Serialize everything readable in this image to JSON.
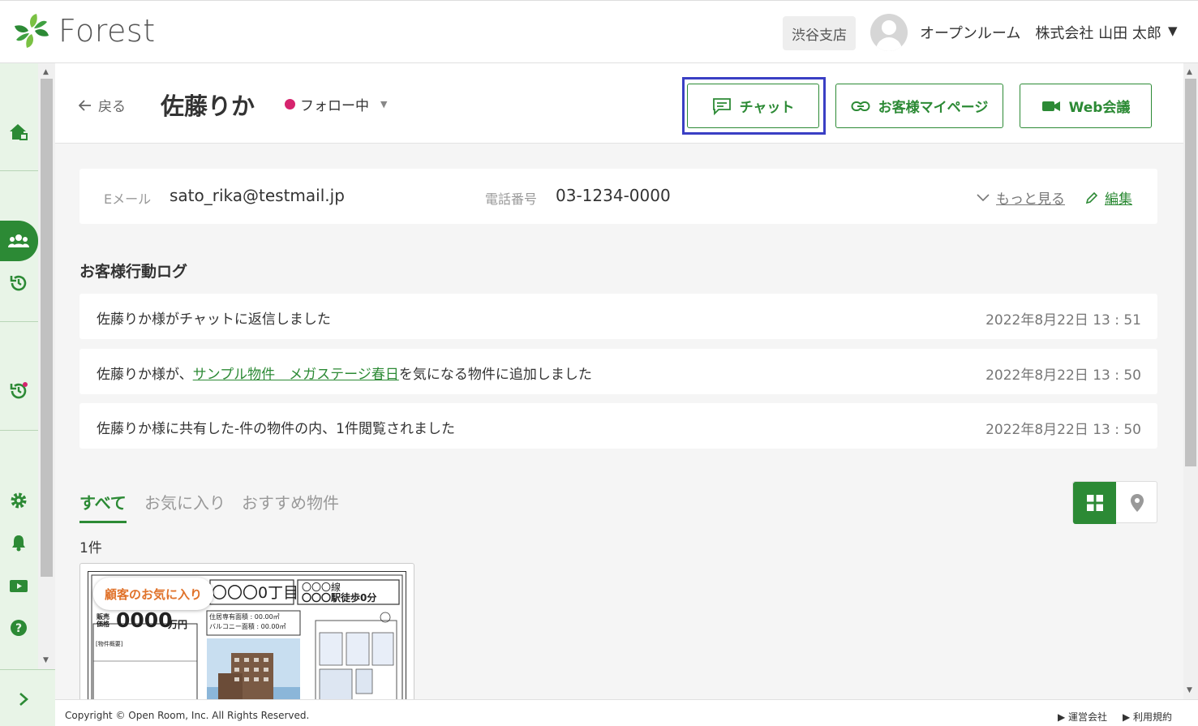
{
  "header": {
    "logo_text": "Forest",
    "branch": "渋谷支店",
    "user": "オープンルーム　株式会社 山田 太郎",
    "caret": "▼"
  },
  "topbar": {
    "back_label": "戻る",
    "customer_name": "佐藤りか",
    "status": "フォロー中",
    "chat_label": "チャット",
    "mypage_label": "お客様マイページ",
    "web_meeting_label": "Web会議"
  },
  "info": {
    "email_label": "Eメール",
    "email": "sato_rika@testmail.jp",
    "phone_label": "電話番号",
    "phone": "03-1234-0000",
    "more_label": "もっと見る",
    "edit_label": "編集"
  },
  "activity": {
    "title": "お客様行動ログ",
    "logs": [
      {
        "text": "佐藤りか様がチャットに返信しました",
        "time": "2022年8月22日 13 : 51"
      },
      {
        "text_before": "佐藤りか様が、",
        "link": "サンプル物件　メガステージ春日",
        "text_after": "を気になる物件に追加しました",
        "time": "2022年8月22日 13 : 50"
      },
      {
        "text": "佐藤りか様に共有した-件の物件の内、1件閲覧されました",
        "time": "2022年8月22日 13 : 50"
      }
    ]
  },
  "tabs": [
    "すべて",
    "お気に入り",
    "おすすめ物件"
  ],
  "count": "1件",
  "property": {
    "badge": "顧客のお気に入り",
    "flyer_address": "〇〇〇0丁目",
    "flyer_line": "〇〇〇線",
    "flyer_station": "〇〇〇駅徒歩0分",
    "flyer_price_label": "販売価格",
    "flyer_price": "0000",
    "flyer_price_unit": "万円",
    "flyer_area1": "住居専有面積 : 00.00㎡",
    "flyer_area2": "バルコニー面積 : 00.00㎡",
    "flyer_summary": "[物件概要]"
  },
  "footer": {
    "copyright": "Copyright © Open Room, Inc. All Rights Reserved.",
    "company": "▶ 運営会社",
    "terms": "▶ 利用規約"
  },
  "colors": {
    "brand_green": "#2c8a35",
    "status_pink": "#d6246e",
    "highlight_blue": "#3a3fc4",
    "badge_orange": "#e0722a"
  }
}
